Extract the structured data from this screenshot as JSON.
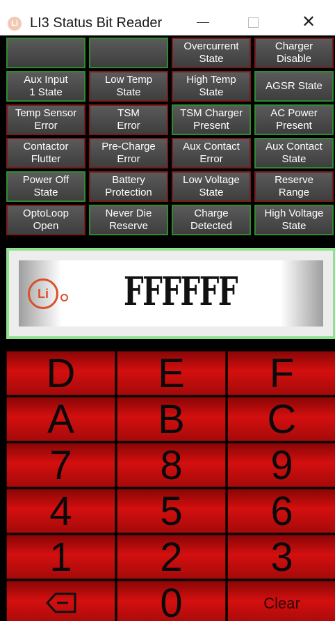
{
  "window": {
    "title": "LI3 Status Bit Reader",
    "icon_name": "app-logo-icon"
  },
  "status_grid": [
    {
      "label": "",
      "state": "on"
    },
    {
      "label": "",
      "state": "on"
    },
    {
      "label": "Overcurrent\nState",
      "state": "off"
    },
    {
      "label": "Charger\nDisable",
      "state": "off"
    },
    {
      "label": "Aux Input\n1 State",
      "state": "on"
    },
    {
      "label": "Low Temp\nState",
      "state": "off"
    },
    {
      "label": "High Temp\nState",
      "state": "off"
    },
    {
      "label": "AGSR State",
      "state": "on"
    },
    {
      "label": "Temp Sensor\nError",
      "state": "off"
    },
    {
      "label": "TSM\nError",
      "state": "off"
    },
    {
      "label": "TSM Charger\nPresent",
      "state": "on"
    },
    {
      "label": "AC Power\nPresent",
      "state": "on"
    },
    {
      "label": "Contactor\nFlutter",
      "state": "off"
    },
    {
      "label": "Pre-Charge\nError",
      "state": "off"
    },
    {
      "label": "Aux Contact\nError",
      "state": "off"
    },
    {
      "label": "Aux Contact\nState",
      "state": "on"
    },
    {
      "label": "Power Off\nState",
      "state": "on"
    },
    {
      "label": "Battery\nProtection",
      "state": "off"
    },
    {
      "label": "Low Voltage\nState",
      "state": "off"
    },
    {
      "label": "Reserve\nRange",
      "state": "off"
    },
    {
      "label": "OptoLoop\nOpen",
      "state": "off"
    },
    {
      "label": "Never Die\nReserve",
      "state": "on"
    },
    {
      "label": "Charge\nDetected",
      "state": "on"
    },
    {
      "label": "High Voltage\nState",
      "state": "on"
    }
  ],
  "display": {
    "value": "FFFFFF",
    "logo_text": "Li"
  },
  "keypad": [
    {
      "label": "D"
    },
    {
      "label": "E"
    },
    {
      "label": "F"
    },
    {
      "label": "A"
    },
    {
      "label": "B"
    },
    {
      "label": "C"
    },
    {
      "label": "7"
    },
    {
      "label": "8"
    },
    {
      "label": "9"
    },
    {
      "label": "4"
    },
    {
      "label": "5"
    },
    {
      "label": "6"
    },
    {
      "label": "1"
    },
    {
      "label": "2"
    },
    {
      "label": "3"
    },
    {
      "label": "",
      "icon": "backspace-icon"
    },
    {
      "label": "0"
    },
    {
      "label": "Clear"
    }
  ],
  "colors": {
    "bit_on_border": "#2e8b2e",
    "bit_off_border": "#7a1a1a",
    "display_border": "#8fe08f",
    "key_red": "#d40f0f",
    "logo_orange": "#d9502a"
  }
}
